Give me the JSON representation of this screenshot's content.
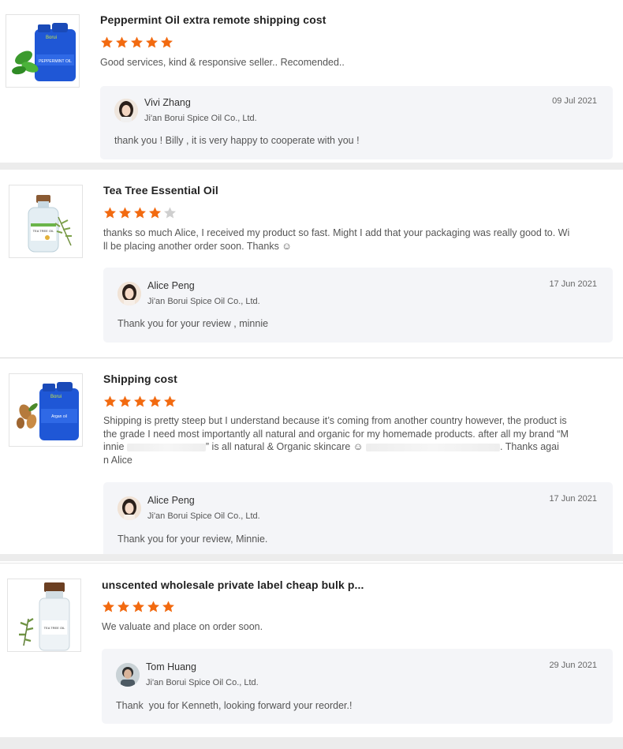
{
  "reviews": [
    {
      "product": "Peppermint Oil extra remote shipping cost",
      "rating": 5,
      "comment": "Good services, kind & responsive seller.. Recomended..",
      "reply": {
        "name": "Vivi Zhang",
        "company": "Ji'an Borui Spice Oil Co., Ltd.",
        "date": "09 Jul 2021",
        "text": "thank you ! Billy , it is very happy to cooperate with you !"
      },
      "thumb_label": "PEPPERMINT OIL"
    },
    {
      "product": "Tea Tree Essential Oil",
      "rating": 4,
      "comment_line1": "thanks so much Alice, I received my product so fast. Might I add that your packaging was really good to. Wi",
      "comment_line2": "ll be placing another order soon. Thanks ☺",
      "reply": {
        "name": "Alice Peng",
        "company": "Ji'an Borui Spice Oil Co., Ltd.",
        "date": "17 Jun 2021",
        "text": "Thank you for your review , minnie"
      },
      "thumb_label": "TEA TREE OIL"
    },
    {
      "product": "Shipping cost",
      "rating": 5,
      "comment_line1": "Shipping is pretty steep but I understand because it’s coming from another country however, the product is",
      "comment_line2": "the grade I need most importantly all natural and organic for my homemade products. after all my brand “M",
      "comment_line3a": "innie",
      "comment_line3b": "” is all natural & Organic skincare ☺",
      "comment_line3c": ". Thanks agai",
      "comment_line4": "n Alice",
      "reply": {
        "name": "Alice Peng",
        "company": "Ji'an Borui Spice Oil Co., Ltd.",
        "date": "17 Jun 2021",
        "text": "Thank you for your review, Minnie."
      },
      "thumb_label": "Argan oil"
    },
    {
      "product": "unscented wholesale private label cheap bulk p...",
      "rating": 5,
      "comment": "We valuate and place on order soon.",
      "reply": {
        "name": "Tom Huang",
        "company": "Ji'an Borui Spice Oil Co., Ltd.",
        "date": "29 Jun 2021",
        "text": "Thank  you for Kenneth, looking forward your reorder.!"
      },
      "thumb_label": "TEA TREE OIL"
    }
  ],
  "colors": {
    "star_filled": "#f26a10",
    "star_empty": "#cfcfcf",
    "reply_bg": "#f4f5f8",
    "separator": "#ececec"
  }
}
